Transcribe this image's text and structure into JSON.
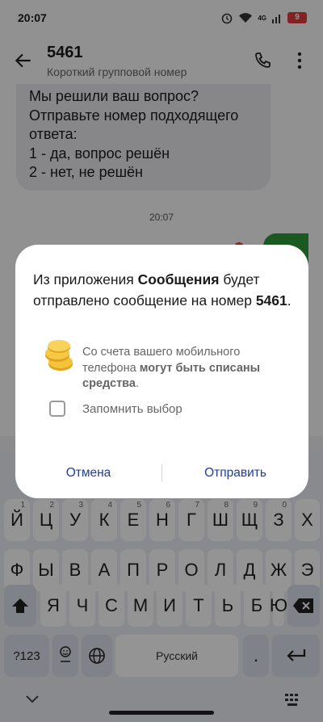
{
  "status_bar": {
    "time": "20:07",
    "network_type": "4G",
    "battery_level": "9"
  },
  "app_bar": {
    "title": "5461",
    "subtitle": "Короткий групповой номер"
  },
  "conversation": {
    "received_message": [
      "Мы решили ваш вопрос?",
      "Отправьте номер подходящего",
      "ответа:",
      "1 - да, вопрос решён",
      "2 - нет, не решён"
    ],
    "timestamp": "20:07"
  },
  "dialog": {
    "message_part1": "Из приложения ",
    "app_name": "Сообщения",
    "message_part2": " будет отправлено сообщение на номер ",
    "number": "5461",
    "message_end": ".",
    "warning_part1": "Со счета вашего мобильного телефона ",
    "warning_bold": "могут быть списаны средства",
    "warning_end": ".",
    "remember_label": "Запомнить выбор",
    "remember_checked": false,
    "cancel_label": "Отмена",
    "send_label": "Отправить"
  },
  "keyboard": {
    "row1": [
      {
        "key": "Й",
        "hint": "1"
      },
      {
        "key": "Ц",
        "hint": "2"
      },
      {
        "key": "У",
        "hint": "3"
      },
      {
        "key": "К",
        "hint": "4"
      },
      {
        "key": "Е",
        "hint": "5"
      },
      {
        "key": "Н",
        "hint": "6"
      },
      {
        "key": "Г",
        "hint": "7"
      },
      {
        "key": "Ш",
        "hint": "8"
      },
      {
        "key": "Щ",
        "hint": "9"
      },
      {
        "key": "З",
        "hint": "0"
      },
      {
        "key": "Х",
        "hint": ""
      }
    ],
    "row2": [
      "Ф",
      "Ы",
      "В",
      "А",
      "П",
      "Р",
      "О",
      "Л",
      "Д",
      "Ж",
      "Э"
    ],
    "row3": [
      "Я",
      "Ч",
      "С",
      "М",
      "И",
      "Т",
      "Ь",
      "Б",
      "Ю"
    ],
    "symbols_label": "?123",
    "space_label": "Русский",
    "period_label": "."
  },
  "icons": {
    "back": "arrow-back-icon",
    "call": "phone-icon",
    "more": "more-vert-icon",
    "coins": "coins-icon",
    "shift": "shift-icon",
    "backspace": "backspace-icon",
    "emoji": "emoji-icon",
    "globe": "globe-icon",
    "enter": "enter-icon",
    "nav_down": "chevron-down-icon",
    "nav_keyboard": "keyboard-grid-icon"
  },
  "colors": {
    "accent_button": "#1f3d9e",
    "sent_bubble": "#2d9b3a",
    "battery_low": "#e23b3b"
  }
}
